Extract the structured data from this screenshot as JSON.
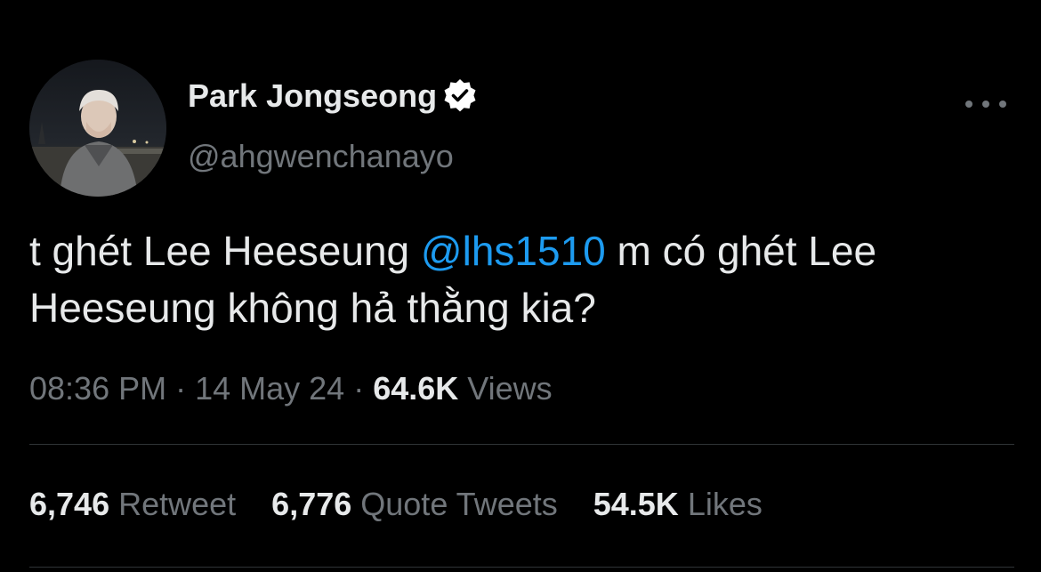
{
  "user": {
    "display_name": "Park Jongseong",
    "handle": "@ahgwenchanayo",
    "verified_icon": "verified-badge-icon",
    "avatar": "profile-avatar"
  },
  "tweet": {
    "text_part1": "t ghét Lee Heeseung ",
    "mention": "@lhs1510",
    "text_part2": " m có ghét Lee Heeseung không hả thằng kia?"
  },
  "meta": {
    "time": "08:36 PM",
    "sep1": " · ",
    "date": "14 May 24",
    "sep2": " · ",
    "views_count": "64.6K",
    "views_label": " Views"
  },
  "stats": {
    "retweets_count": "6,746",
    "retweets_label": "Retweet",
    "quotes_count": "6,776",
    "quotes_label": "Quote Tweets",
    "likes_count": "54.5K",
    "likes_label": "Likes"
  },
  "colors": {
    "background": "#000000",
    "text_primary": "#e7e9ea",
    "text_secondary": "#71767b",
    "accent": "#1d9bf0",
    "divider": "#2f3336"
  },
  "icons": {
    "more": "more-dots-icon",
    "verified": "verified-badge-icon"
  }
}
